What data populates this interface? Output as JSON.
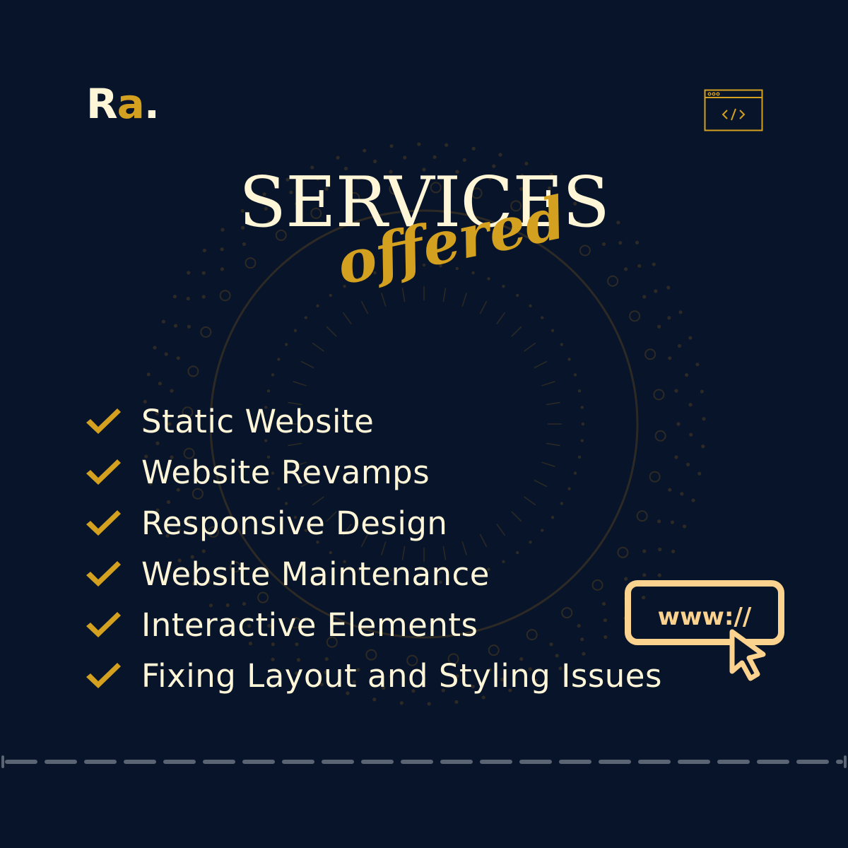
{
  "brand": {
    "logo_r": "R",
    "logo_a": "a",
    "logo_dot": ".",
    "accent_color": "#d3a11f",
    "cream_color": "#fff6d8",
    "background_color": "#08142a"
  },
  "header": {
    "title": "SERVICES",
    "subtitle": "offered",
    "code_window_icon": "browser-code-icon"
  },
  "services": [
    {
      "label": "Static Website",
      "icon": "check-icon"
    },
    {
      "label": "Website Revamps",
      "icon": "check-icon"
    },
    {
      "label": "Responsive Design",
      "icon": "check-icon"
    },
    {
      "label": "Website Maintenance",
      "icon": "check-icon"
    },
    {
      "label": "Interactive Elements",
      "icon": "check-icon"
    },
    {
      "label": "Fixing Layout and Styling Issues",
      "icon": "check-icon"
    }
  ],
  "url_badge": {
    "text": "www://",
    "icon": "cursor-pointer-icon",
    "color": "#fcd28f"
  }
}
